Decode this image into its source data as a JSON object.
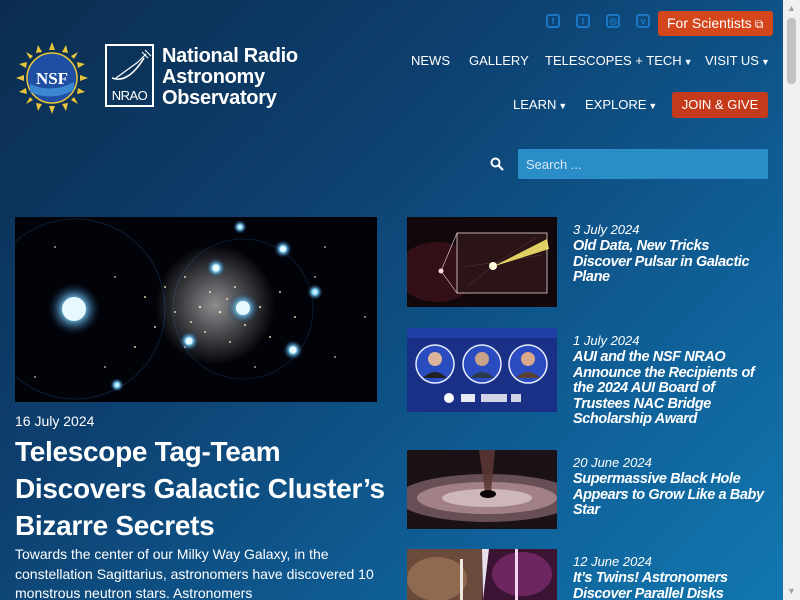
{
  "header": {
    "social_icons": [
      "facebook-icon",
      "twitter-icon",
      "instagram-icon",
      "vimeo-icon"
    ],
    "scientists_button": "For Scientists",
    "org_name_lines": [
      "National Radio",
      "Astronomy",
      "Observatory"
    ],
    "nsf_logo_text": "NSF",
    "nrao_logo_text": "NRAO"
  },
  "nav": {
    "news": "NEWS",
    "gallery": "GALLERY",
    "telescopes": "TELESCOPES + TECH",
    "visit": "VISIT US",
    "learn": "LEARN",
    "explore": "EXPLORE",
    "join": "JOIN & GIVE"
  },
  "search": {
    "placeholder": "Search ..."
  },
  "featured": {
    "date": "16 July 2024",
    "title": "Telescope Tag-Team Discovers Galactic Cluster’s Bizarre Secrets",
    "description": "Towards the center of our Milky Way Galaxy, in the constellation Sagittarius, astronomers have discovered 10 monstrous neutron stars. Astronomers"
  },
  "news_items": [
    {
      "date": "3 July 2024",
      "title": "Old Data, New Tricks Discover Pulsar in Galactic Plane"
    },
    {
      "date": "1 July 2024",
      "title": "AUI and the NSF NRAO Announce the Recipients of the 2024 AUI Board of Trustees NAC Bridge Scholarship Award"
    },
    {
      "date": "20 June 2024",
      "title": "Supermassive Black Hole Appears to Grow Like a Baby Star"
    },
    {
      "date": "12 June 2024",
      "title": "It’s Twins! Astronomers Discover Parallel Disks"
    }
  ],
  "colors": {
    "accent_button": "#d4471c",
    "search_bg": "#2a8dc8",
    "social_blue": "#1b77c4"
  }
}
